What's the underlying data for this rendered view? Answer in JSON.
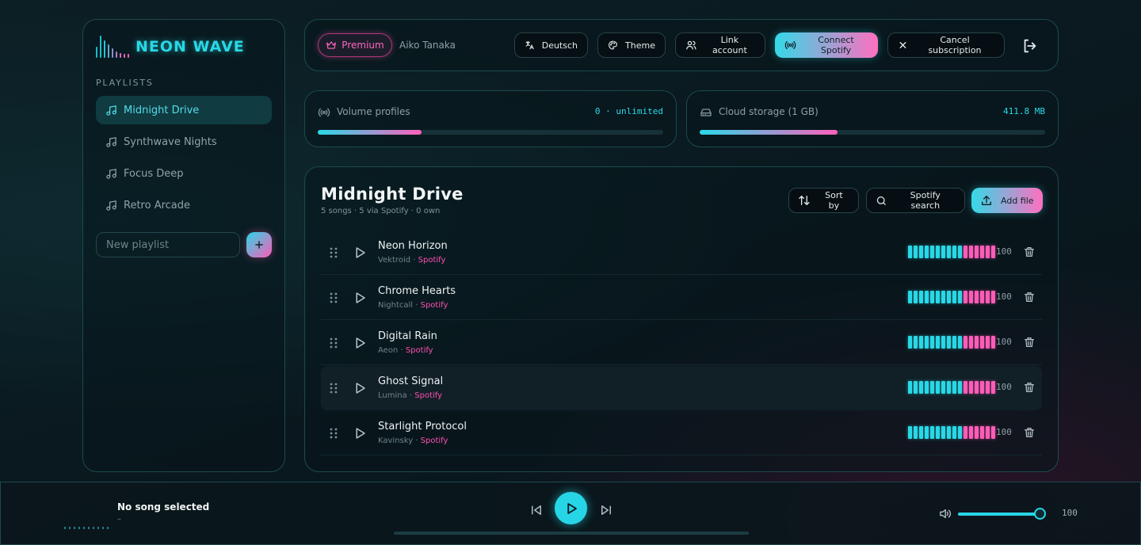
{
  "app": {
    "name": "NEON WAVE"
  },
  "colors": {
    "accent_cyan": "#29d8e6",
    "accent_pink": "#ff5cb8",
    "background": "#0a1a20"
  },
  "sidebar": {
    "section_label": "PLAYLISTS",
    "items": [
      {
        "label": "Midnight Drive",
        "active": true,
        "icon": "music-note-icon"
      },
      {
        "label": "Synthwave Nights",
        "active": false,
        "icon": "music-note-icon"
      },
      {
        "label": "Focus Deep",
        "active": false,
        "icon": "music-note-icon"
      },
      {
        "label": "Retro Arcade",
        "active": false,
        "icon": "music-note-icon"
      }
    ],
    "new_playlist_placeholder": "New playlist"
  },
  "header": {
    "premium_label": "Premium",
    "user_name": "Aiko Tanaka",
    "buttons": {
      "language": "Deutsch",
      "theme": "Theme",
      "link_account": "Link account",
      "connect_spotify": "Connect Spotify",
      "cancel_subscription": "Cancel subscription"
    }
  },
  "stats": {
    "volume": {
      "label": "Volume profiles",
      "value": "0 · unlimited",
      "fill_fraction": 0.3
    },
    "storage": {
      "label": "Cloud storage (1 GB)",
      "value": "411.8 MB",
      "fill_fraction": 0.4
    }
  },
  "main": {
    "title": "Midnight Drive",
    "subtitle": "5 songs · 5 via Spotify · 0 own",
    "buttons": {
      "sort": "Sort by",
      "spotify_search": "Spotify search",
      "add_file": "Add file"
    },
    "songs": [
      {
        "title": "Neon Horizon",
        "artist": "Vektroid",
        "source": "Spotify",
        "volume": "100"
      },
      {
        "title": "Chrome Hearts",
        "artist": "Nightcall",
        "source": "Spotify",
        "volume": "100"
      },
      {
        "title": "Digital Rain",
        "artist": "Aeon",
        "source": "Spotify",
        "volume": "100"
      },
      {
        "title": "Ghost Signal",
        "artist": "Lumina",
        "source": "Spotify",
        "volume": "100"
      },
      {
        "title": "Starlight Protocol",
        "artist": "Kavinsky",
        "source": "Spotify",
        "volume": "100"
      }
    ],
    "meter": {
      "cyan_segments": 10,
      "pink_segments": 6
    }
  },
  "player": {
    "now_playing": "No song selected",
    "now_sub": "–",
    "volume_value": "100",
    "volume_fraction": 1.0,
    "progress_fraction": 0
  }
}
